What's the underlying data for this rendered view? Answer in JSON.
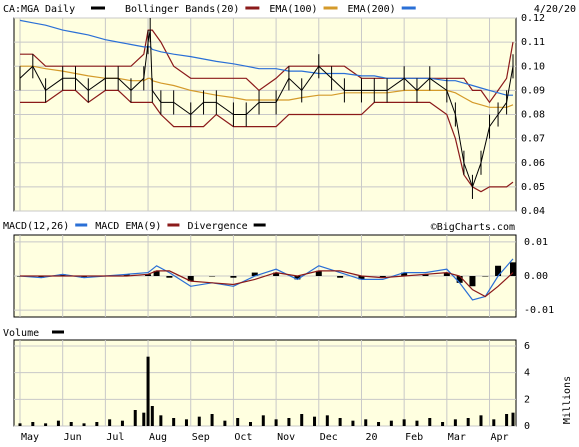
{
  "header": {
    "symbol": "CA:MGA",
    "period": "Daily",
    "date": "4/20/20"
  },
  "legend_main": [
    {
      "label": "Bollinger Bands(20)",
      "color": "#8b1a1a"
    },
    {
      "label": "EMA(100)",
      "color": "#d49a2a"
    },
    {
      "label": "EMA(200)",
      "color": "#2a6fd6"
    }
  ],
  "legend_macd": [
    {
      "label": "MACD(12,26)",
      "color": "#2a6fd6"
    },
    {
      "label": "MACD EMA(9)",
      "color": "#8b1a1a"
    },
    {
      "label": "Divergence",
      "color": "#000000"
    }
  ],
  "watermark": "©BigCharts.com",
  "volume_label": "Volume",
  "volume_unit": "Millions",
  "colors": {
    "panel_bg": "#ffffe0",
    "grid": "#c8c8c8",
    "price": "#000000",
    "bollinger": "#8b1a1a",
    "ema100": "#d49a2a",
    "ema200": "#2a6fd6",
    "macd": "#2a6fd6",
    "macd_signal": "#8b1a1a",
    "divergence": "#000000",
    "volume": "#000000"
  },
  "chart_data": [
    {
      "type": "line",
      "name_ref": "price-panel",
      "x_ticks": [
        "May",
        "Jun",
        "Jul",
        "Aug",
        "Sep",
        "Oct",
        "Nov",
        "Dec",
        "20",
        "Feb",
        "Mar",
        "Apr"
      ],
      "y_ticks": [
        "0.12",
        "0.11",
        "0.10",
        "0.09",
        "0.08",
        "0.07",
        "0.06",
        "0.05",
        "0.04"
      ],
      "ylim": [
        0.04,
        0.12
      ],
      "x_months": [
        0,
        1,
        2,
        3,
        4,
        5,
        6,
        7,
        8,
        9,
        10,
        11,
        11.55
      ],
      "series": [
        {
          "name": "CA:MGA",
          "x": [
            0,
            0.3,
            0.6,
            1.0,
            1.3,
            1.6,
            2.0,
            2.3,
            2.6,
            2.9,
            3.0,
            3.05,
            3.1,
            3.3,
            3.6,
            4.0,
            4.3,
            4.6,
            5.0,
            5.3,
            5.6,
            6.0,
            6.3,
            6.6,
            7.0,
            7.3,
            7.6,
            8.0,
            8.3,
            8.6,
            9.0,
            9.3,
            9.6,
            10.0,
            10.2,
            10.4,
            10.6,
            10.8,
            11.0,
            11.2,
            11.4,
            11.55
          ],
          "y": [
            0.095,
            0.1,
            0.09,
            0.095,
            0.095,
            0.09,
            0.095,
            0.095,
            0.09,
            0.095,
            0.11,
            0.115,
            0.09,
            0.085,
            0.085,
            0.08,
            0.085,
            0.085,
            0.08,
            0.08,
            0.085,
            0.085,
            0.095,
            0.09,
            0.1,
            0.095,
            0.09,
            0.09,
            0.09,
            0.09,
            0.095,
            0.09,
            0.095,
            0.09,
            0.08,
            0.06,
            0.05,
            0.06,
            0.075,
            0.08,
            0.085,
            0.1
          ]
        },
        {
          "name": "Bollinger Bands(20)",
          "upper": [
            0.105,
            0.105,
            0.1,
            0.1,
            0.1,
            0.1,
            0.1,
            0.1,
            0.1,
            0.105,
            0.115,
            0.115,
            0.115,
            0.11,
            0.1,
            0.095,
            0.095,
            0.095,
            0.095,
            0.095,
            0.09,
            0.095,
            0.1,
            0.1,
            0.1,
            0.1,
            0.1,
            0.095,
            0.095,
            0.095,
            0.095,
            0.095,
            0.095,
            0.095,
            0.095,
            0.095,
            0.09,
            0.09,
            0.085,
            0.09,
            0.095,
            0.11
          ],
          "lower": [
            0.085,
            0.085,
            0.085,
            0.09,
            0.09,
            0.085,
            0.09,
            0.09,
            0.085,
            0.085,
            0.085,
            0.085,
            0.085,
            0.08,
            0.075,
            0.075,
            0.075,
            0.08,
            0.075,
            0.075,
            0.075,
            0.075,
            0.08,
            0.08,
            0.08,
            0.08,
            0.08,
            0.08,
            0.085,
            0.085,
            0.085,
            0.085,
            0.085,
            0.08,
            0.07,
            0.055,
            0.05,
            0.048,
            0.05,
            0.05,
            0.05,
            0.052
          ]
        },
        {
          "name": "EMA(100)",
          "y": [
            0.1,
            0.1,
            0.099,
            0.098,
            0.097,
            0.096,
            0.095,
            0.095,
            0.094,
            0.094,
            0.095,
            0.095,
            0.094,
            0.093,
            0.092,
            0.09,
            0.089,
            0.088,
            0.087,
            0.086,
            0.086,
            0.086,
            0.086,
            0.087,
            0.088,
            0.088,
            0.089,
            0.089,
            0.089,
            0.089,
            0.09,
            0.09,
            0.09,
            0.09,
            0.089,
            0.087,
            0.085,
            0.084,
            0.083,
            0.083,
            0.083,
            0.084
          ]
        },
        {
          "name": "EMA(200)",
          "y": [
            0.119,
            0.118,
            0.117,
            0.115,
            0.114,
            0.113,
            0.111,
            0.11,
            0.109,
            0.108,
            0.108,
            0.108,
            0.107,
            0.106,
            0.105,
            0.104,
            0.103,
            0.102,
            0.101,
            0.1,
            0.099,
            0.099,
            0.098,
            0.098,
            0.097,
            0.097,
            0.097,
            0.096,
            0.096,
            0.095,
            0.095,
            0.095,
            0.095,
            0.094,
            0.094,
            0.093,
            0.092,
            0.091,
            0.09,
            0.089,
            0.088,
            0.088
          ]
        }
      ]
    },
    {
      "type": "line",
      "name_ref": "macd-panel",
      "y_ticks": [
        "0.01",
        "0.00",
        "-0.01"
      ],
      "ylim": [
        -0.012,
        0.012
      ],
      "x": [
        0,
        0.5,
        1.0,
        1.5,
        2.0,
        2.5,
        3.0,
        3.2,
        3.5,
        4.0,
        4.5,
        5.0,
        5.5,
        6.0,
        6.5,
        7.0,
        7.5,
        8.0,
        8.5,
        9.0,
        9.5,
        10.0,
        10.3,
        10.6,
        10.9,
        11.2,
        11.55
      ],
      "series": [
        {
          "name": "MACD(12,26)",
          "values": [
            0.0,
            -0.0005,
            0.0005,
            -0.0005,
            0.0,
            0.0005,
            0.001,
            0.003,
            0.001,
            -0.003,
            -0.002,
            -0.003,
            0.0,
            0.002,
            -0.001,
            0.003,
            0.001,
            -0.001,
            -0.001,
            0.001,
            0.001,
            0.002,
            -0.002,
            -0.007,
            -0.006,
            0.0,
            0.005
          ]
        },
        {
          "name": "MACD EMA(9)",
          "values": [
            0.0,
            0.0,
            0.0,
            0.0,
            0.0,
            0.0,
            0.0005,
            0.0015,
            0.0015,
            -0.0015,
            -0.002,
            -0.0025,
            -0.001,
            0.001,
            0.0,
            0.0015,
            0.0015,
            0.0,
            -0.0005,
            0.0,
            0.0005,
            0.001,
            0.0,
            -0.004,
            -0.006,
            -0.003,
            0.001
          ]
        },
        {
          "name": "Divergence",
          "values": [
            0.0,
            -0.0005,
            0.0005,
            -0.0005,
            0.0,
            0.0005,
            0.0005,
            0.0015,
            -0.0005,
            -0.0015,
            0.0,
            -0.0005,
            0.001,
            0.001,
            -0.001,
            0.0015,
            -0.0005,
            -0.001,
            -0.0005,
            0.001,
            0.0005,
            0.001,
            -0.002,
            -0.003,
            0.0,
            0.003,
            0.004
          ]
        }
      ]
    },
    {
      "type": "bar",
      "name_ref": "volume-panel",
      "y_ticks": [
        "6",
        "4",
        "2",
        "0"
      ],
      "ylim": [
        0,
        6
      ],
      "x": [
        0,
        0.3,
        0.6,
        0.9,
        1.2,
        1.5,
        1.8,
        2.1,
        2.4,
        2.7,
        2.9,
        3.0,
        3.1,
        3.3,
        3.6,
        3.9,
        4.2,
        4.5,
        4.8,
        5.1,
        5.4,
        5.7,
        6.0,
        6.3,
        6.6,
        6.9,
        7.2,
        7.5,
        7.8,
        8.1,
        8.4,
        8.7,
        9.0,
        9.3,
        9.6,
        9.9,
        10.2,
        10.5,
        10.8,
        11.1,
        11.4,
        11.55
      ],
      "values": [
        0.2,
        0.3,
        0.2,
        0.4,
        0.3,
        0.2,
        0.3,
        0.5,
        0.4,
        1.2,
        1.0,
        5.2,
        1.5,
        0.8,
        0.6,
        0.5,
        0.7,
        0.9,
        0.4,
        0.6,
        0.3,
        0.8,
        0.5,
        0.6,
        0.9,
        0.7,
        0.8,
        0.6,
        0.4,
        0.5,
        0.3,
        0.4,
        0.5,
        0.4,
        0.6,
        0.3,
        0.5,
        0.6,
        0.8,
        0.5,
        0.9,
        1.0
      ]
    }
  ]
}
